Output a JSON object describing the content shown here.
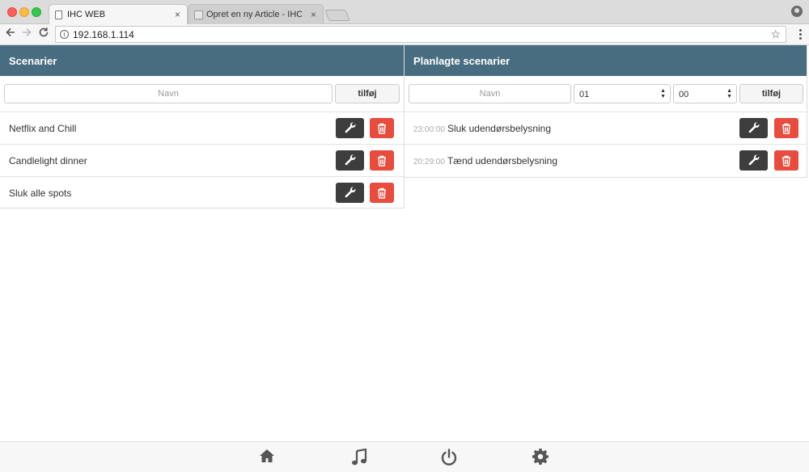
{
  "browser": {
    "tabs": [
      {
        "title": "IHC WEB",
        "active": true
      },
      {
        "title": "Opret en ny Article - IHC-User",
        "active": false
      }
    ],
    "close_glyph": "×",
    "url": "192.168.1.114",
    "info_glyph": "i",
    "star_glyph": "☆"
  },
  "scenarier": {
    "title": "Scenarier",
    "name_placeholder": "Navn",
    "add_label": "tilføj",
    "items": [
      {
        "name": "Netflix and Chill"
      },
      {
        "name": "Candlelight dinner"
      },
      {
        "name": "Sluk alle spots"
      }
    ]
  },
  "planlagte": {
    "title": "Planlagte scenarier",
    "name_placeholder": "Navn",
    "hour_value": "01",
    "minute_value": "00",
    "add_label": "tilføj",
    "items": [
      {
        "time": "23:00:00",
        "name": "Sluk udendørsbelysning"
      },
      {
        "time": "20:29:00",
        "name": "Tænd udendørsbelysning"
      }
    ]
  },
  "footer": {
    "icons": [
      "home-icon",
      "music-icon",
      "power-icon",
      "gear-icon"
    ]
  },
  "colors": {
    "header": "#486d81",
    "edit_button": "#3d3d3d",
    "delete_button": "#e84c3d"
  }
}
